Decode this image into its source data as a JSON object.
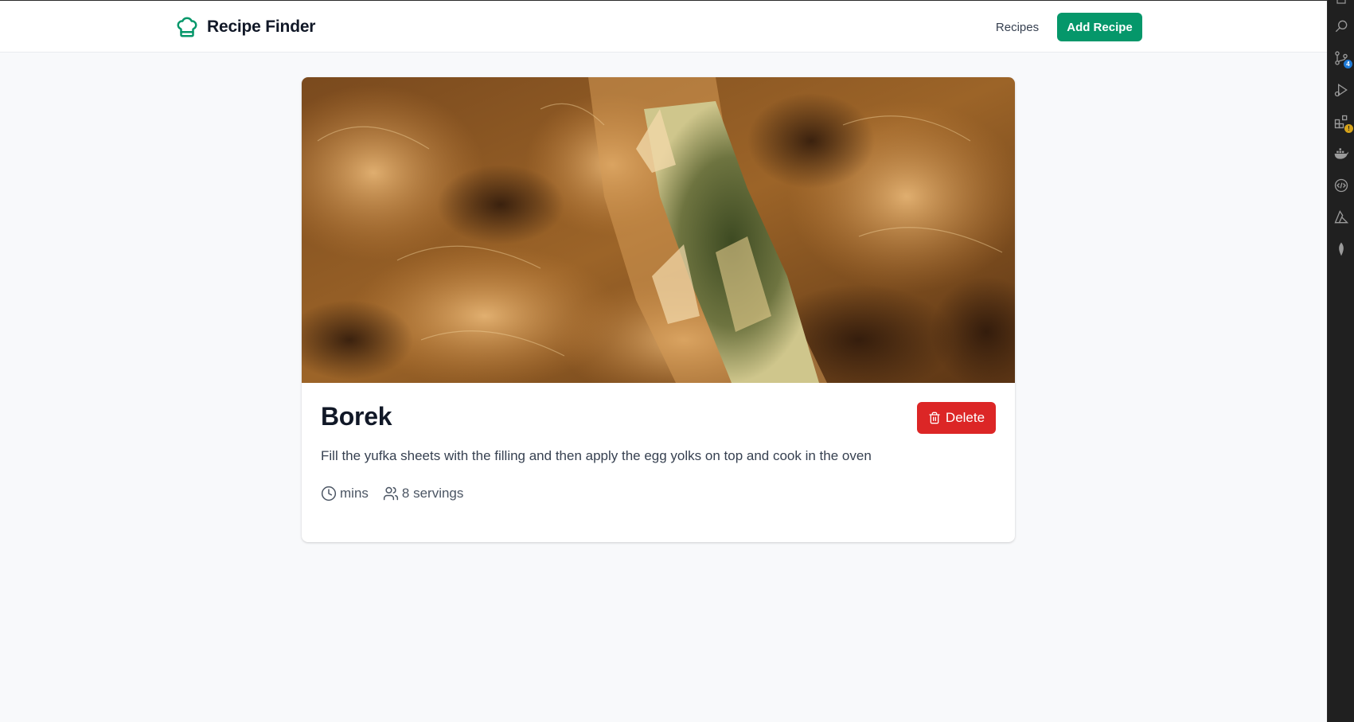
{
  "header": {
    "brand_name": "Recipe Finder",
    "brand_icon": "chef-hat-icon",
    "nav_recipes": "Recipes",
    "add_recipe": "Add Recipe"
  },
  "recipe": {
    "title": "Borek",
    "delete_label": "Delete",
    "description": "Fill the yufka sheets with the filling and then apply the egg yolks on top and cook in the oven",
    "time_label": "mins",
    "servings_label": "8 servings",
    "image_alt": "photo-of-borek"
  },
  "sidebar": {
    "scm_badge": "4",
    "extensions_badge": "!",
    "icons": [
      "files-icon",
      "search-icon",
      "source-control-icon",
      "run-debug-icon",
      "extensions-icon",
      "docker-icon",
      "remote-icon",
      "azure-icon",
      "mongodb-icon"
    ]
  },
  "colors": {
    "accent": "#05976a",
    "danger": "#dc2626",
    "background": "#f8f9fb"
  }
}
